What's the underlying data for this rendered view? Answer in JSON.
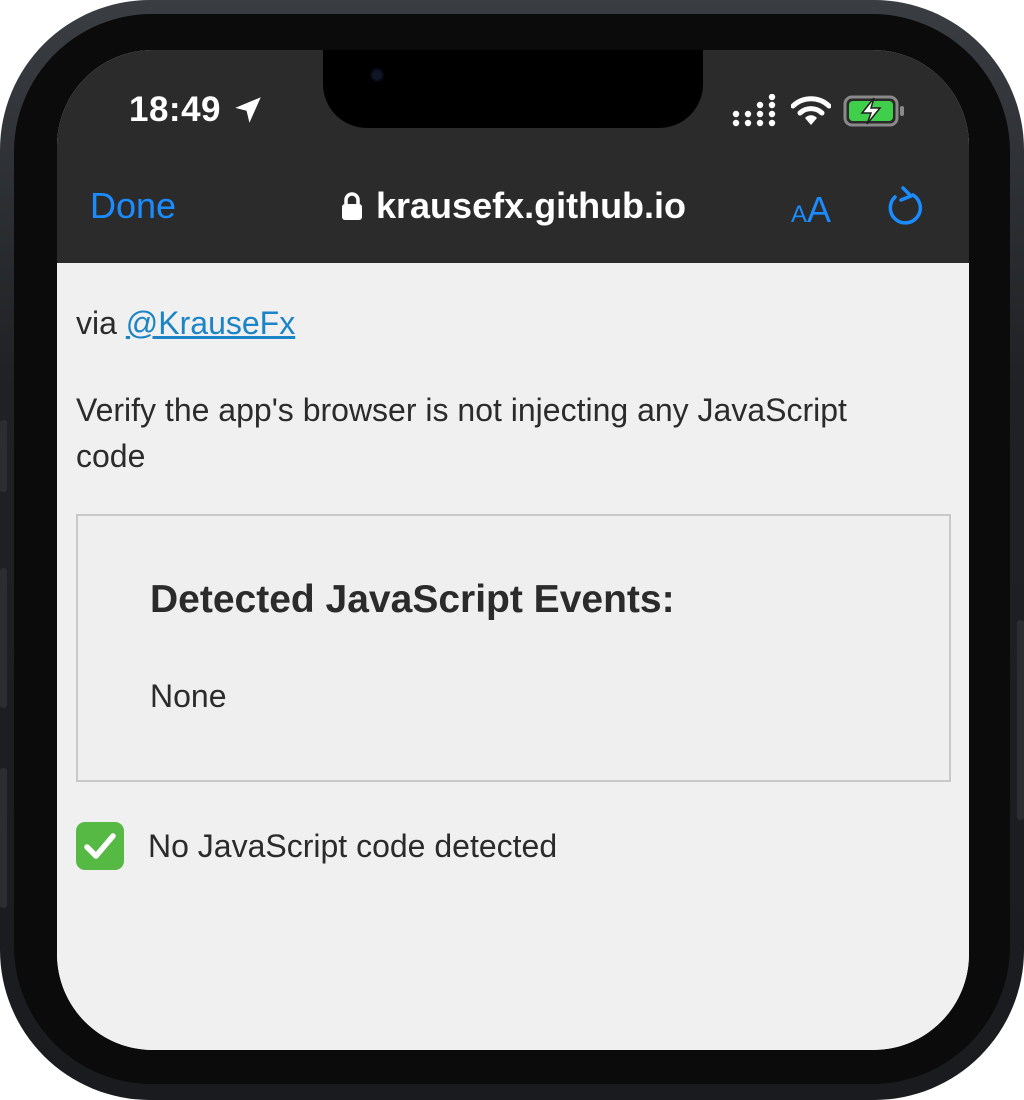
{
  "status_bar": {
    "time": "18:49",
    "icons": [
      "location-arrow-icon",
      "cellular-signal-icon",
      "wifi-icon",
      "battery-charging-icon"
    ]
  },
  "browser": {
    "done_label": "Done",
    "url": "krausefx.github.io",
    "text_size_label_small": "A",
    "text_size_label_large": "A",
    "accent_color": "#1a8cff"
  },
  "page": {
    "via_prefix": "via",
    "via_link": "@KrauseFx",
    "verify_text": "Verify the app's browser is not injecting any JavaScript code",
    "events_title": "Detected JavaScript Events:",
    "events_value": "None",
    "result_text": "No JavaScript code detected"
  }
}
